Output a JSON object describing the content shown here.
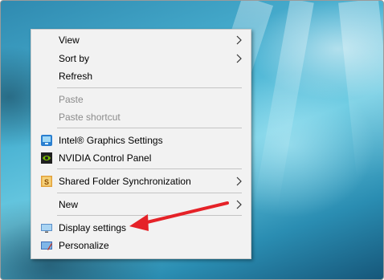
{
  "context_menu": {
    "items": [
      {
        "label": "View",
        "submenu": true
      },
      {
        "label": "Sort by",
        "submenu": true
      },
      {
        "label": "Refresh"
      },
      {
        "label": "Paste",
        "disabled": true
      },
      {
        "label": "Paste shortcut",
        "disabled": true
      },
      {
        "label": "Intel® Graphics Settings",
        "icon": "intel-graphics-icon"
      },
      {
        "label": "NVIDIA Control Panel",
        "icon": "nvidia-icon"
      },
      {
        "label": "Shared Folder Synchronization",
        "icon": "shared-folder-sync-icon",
        "submenu": true
      },
      {
        "label": "New",
        "submenu": true
      },
      {
        "label": "Display settings",
        "icon": "display-settings-icon"
      },
      {
        "label": "Personalize",
        "icon": "personalize-icon"
      }
    ]
  },
  "annotation": {
    "arrow_color": "#e52228",
    "points_to": "Display settings"
  }
}
